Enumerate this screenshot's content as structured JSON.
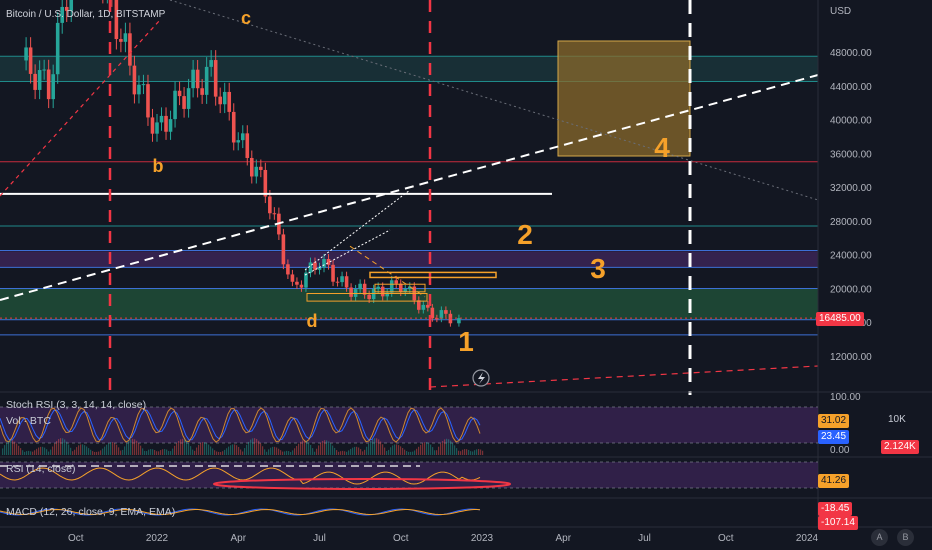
{
  "header": {
    "title": "Bitcoin / U.S. Dollar, 1D, BITSTAMP",
    "currency": "USD"
  },
  "price_axis_ticks": [
    "48000.00",
    "44000.00",
    "40000.00",
    "36000.00",
    "32000.00",
    "28000.00",
    "24000.00",
    "20000.00",
    "16000.00",
    "12000.00"
  ],
  "price_tag": "16485.00",
  "time_axis_ticks": [
    "Oct",
    "2022",
    "Apr",
    "Jul",
    "Oct",
    "2023",
    "Apr",
    "Jul",
    "Oct",
    "2024"
  ],
  "indicators": {
    "stoch": {
      "label": "Stoch RSI (3, 3, 14, 14, close)",
      "k": "31.02",
      "d": "23.45"
    },
    "vol": {
      "label": "Vol · BTC",
      "axis": "10K",
      "value": "2.124K"
    },
    "rsi": {
      "label": "RSI (14, close)",
      "value": "41.26"
    },
    "macd": {
      "label": "MACD (12, 26, close, 9, EMA, EMA)",
      "v1": "-18.45",
      "v2": "-107.14"
    },
    "stoch_axis": [
      "100.00",
      "0.00"
    ]
  },
  "annotations": {
    "b": "b",
    "c": "c",
    "d": "d",
    "n1": "1",
    "n2": "2",
    "n3": "3",
    "n4": "4"
  },
  "footer_buttons": {
    "a": "A",
    "b": "B"
  },
  "colors": {
    "background": "#131722",
    "orange": "#f5a12a",
    "red_dashed": "#f23645",
    "white_line": "#ffffff",
    "green_zone": "#1f4a36",
    "purple_zone": "#3b2456",
    "teal_line": "#1f8a8a",
    "blue_line": "#3d6fd6",
    "red_line": "#c62c3c",
    "price_tag": "#f23645",
    "stoch_k": "#f5a12a",
    "stoch_d": "#2962ff"
  },
  "chart_data": {
    "type": "candlestick",
    "title": "Bitcoin / U.S. Dollar, 1D, BITSTAMP",
    "ylabel": "USD",
    "ylim": [
      10000,
      52000
    ],
    "x": [
      "2021-08",
      "2021-09",
      "2021-10",
      "2021-11",
      "2021-12",
      "2022-01",
      "2022-02",
      "2022-03",
      "2022-04",
      "2022-05",
      "2022-06",
      "2022-07",
      "2022-08",
      "2022-09",
      "2022-10",
      "2022-11",
      "2022-12"
    ],
    "close": [
      47000,
      43800,
      61000,
      57000,
      46300,
      38500,
      43200,
      45500,
      37700,
      31800,
      19900,
      23300,
      20000,
      19400,
      20500,
      17100,
      16485
    ],
    "last_price": 16485,
    "horizontal_levels": [
      47500,
      35000,
      31200,
      27400,
      24500,
      22500,
      20000,
      16200,
      14500
    ],
    "projection_box": {
      "x_start": "2023-03",
      "x_end": "2023-09",
      "y_low": 36000,
      "y_high": 49500
    }
  }
}
